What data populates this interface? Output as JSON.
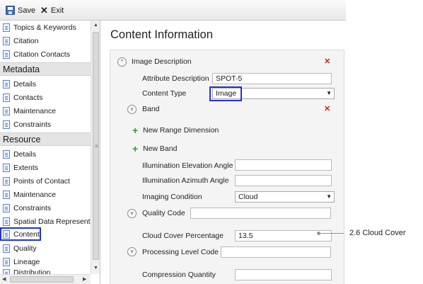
{
  "toolbar": {
    "save_label": "Save",
    "exit_label": "Exit"
  },
  "sidebar": {
    "group1_items": [
      "Topics & Keywords",
      "Citation",
      "Citation Contacts"
    ],
    "metadata_header": "Metadata",
    "metadata_items": [
      "Details",
      "Contacts",
      "Maintenance",
      "Constraints"
    ],
    "resource_header": "Resource",
    "resource_items": [
      "Details",
      "Extents",
      "Points of Contact",
      "Maintenance",
      "Constraints",
      "Spatial Data Representat",
      "Content",
      "Quality",
      "Lineage",
      "Distribution"
    ],
    "selected_item": "Content"
  },
  "main": {
    "page_title": "Content Information",
    "image_description": {
      "label": "Image Description",
      "attribute_description_label": "Attribute Description",
      "attribute_description_value": "SPOT-5",
      "content_type_label": "Content Type",
      "content_type_value": "Image"
    },
    "band": {
      "label": "Band",
      "new_range_dimension": "New Range Dimension",
      "new_band": "New Band",
      "illumination_elevation_label": "Illumination Elevation Angle",
      "illumination_elevation_value": "",
      "illumination_azimuth_label": "Illumination Azimuth Angle",
      "illumination_azimuth_value": "",
      "imaging_condition_label": "Imaging Condition",
      "imaging_condition_value": "Cloud"
    },
    "quality_code": {
      "label": "Quality Code",
      "value": ""
    },
    "cloud_cover": {
      "label": "Cloud Cover Percentage",
      "value": "13.5"
    },
    "processing_level": {
      "label": "Processing Level Code",
      "value": ""
    },
    "compression": {
      "label": "Compression Quantity",
      "value": ""
    }
  },
  "callout": {
    "text": "2.6 Cloud Cover"
  },
  "colors": {
    "highlight": "#2533c9",
    "delete": "#cc2222",
    "add": "#2f9a33"
  }
}
